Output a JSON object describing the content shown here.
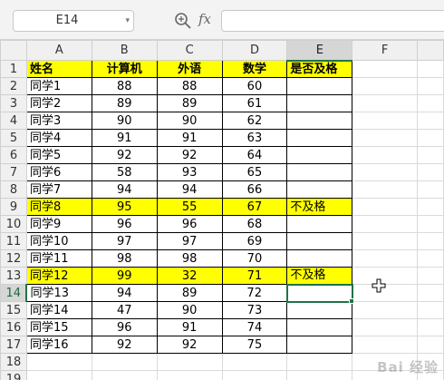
{
  "formula_bar": {
    "name_box": "E14",
    "fx_label": "fx",
    "formula": ""
  },
  "column_headers": [
    "A",
    "B",
    "C",
    "D",
    "E",
    "F"
  ],
  "selected_column": "E",
  "selected_row": "14",
  "header_row": {
    "row": "1",
    "cells": [
      "姓名",
      "计算机",
      "外语",
      "数学",
      "是否及格"
    ]
  },
  "rows": [
    {
      "row": "2",
      "cells": [
        "同学1",
        "88",
        "88",
        "60",
        ""
      ]
    },
    {
      "row": "3",
      "cells": [
        "同学2",
        "89",
        "89",
        "61",
        ""
      ]
    },
    {
      "row": "4",
      "cells": [
        "同学3",
        "90",
        "90",
        "62",
        ""
      ]
    },
    {
      "row": "5",
      "cells": [
        "同学4",
        "91",
        "91",
        "63",
        ""
      ]
    },
    {
      "row": "6",
      "cells": [
        "同学5",
        "92",
        "92",
        "64",
        ""
      ]
    },
    {
      "row": "7",
      "cells": [
        "同学6",
        "58",
        "93",
        "65",
        ""
      ]
    },
    {
      "row": "8",
      "cells": [
        "同学7",
        "94",
        "94",
        "66",
        ""
      ]
    },
    {
      "row": "9",
      "cells": [
        "同学8",
        "95",
        "55",
        "67",
        "不及格"
      ]
    },
    {
      "row": "10",
      "cells": [
        "同学9",
        "96",
        "96",
        "68",
        ""
      ]
    },
    {
      "row": "11",
      "cells": [
        "同学10",
        "97",
        "97",
        "69",
        ""
      ]
    },
    {
      "row": "12",
      "cells": [
        "同学11",
        "98",
        "98",
        "70",
        ""
      ]
    },
    {
      "row": "13",
      "cells": [
        "同学12",
        "99",
        "32",
        "71",
        "不及格"
      ]
    },
    {
      "row": "14",
      "cells": [
        "同学13",
        "94",
        "89",
        "72",
        ""
      ]
    },
    {
      "row": "15",
      "cells": [
        "同学14",
        "47",
        "90",
        "73",
        ""
      ]
    },
    {
      "row": "16",
      "cells": [
        "同学15",
        "96",
        "91",
        "74",
        ""
      ]
    },
    {
      "row": "17",
      "cells": [
        "同学16",
        "92",
        "92",
        "75",
        ""
      ]
    }
  ],
  "empty_rows": [
    "18",
    "19"
  ],
  "highlight_color": "#ffff00",
  "selection_color": "#217346",
  "watermark": "Bai 经验"
}
